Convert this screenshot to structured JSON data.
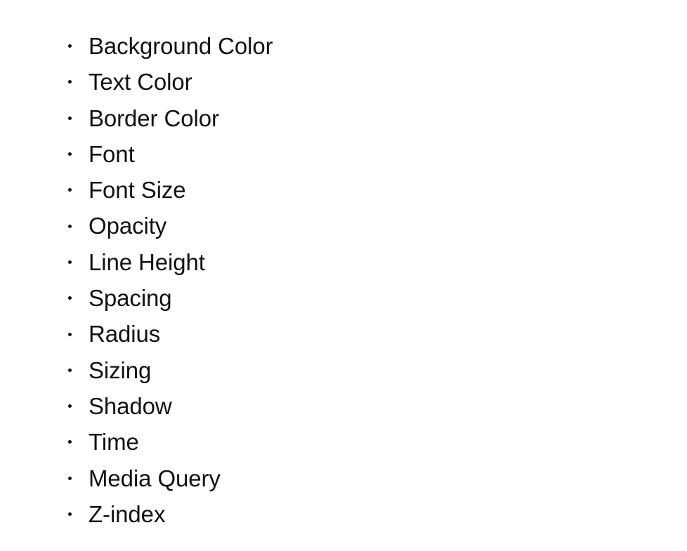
{
  "document": {
    "background_color": "#ffffff",
    "text_color": "#121212",
    "bullet_glyph": "•"
  },
  "list": {
    "marker_style": "disc",
    "items": [
      {
        "label": "Background Color"
      },
      {
        "label": "Text Color"
      },
      {
        "label": "Border Color"
      },
      {
        "label": "Font"
      },
      {
        "label": "Font Size"
      },
      {
        "label": "Opacity"
      },
      {
        "label": "Line Height"
      },
      {
        "label": "Spacing"
      },
      {
        "label": "Radius"
      },
      {
        "label": "Sizing"
      },
      {
        "label": "Shadow"
      },
      {
        "label": "Time"
      },
      {
        "label": "Media Query"
      },
      {
        "label": "Z-index"
      }
    ]
  }
}
